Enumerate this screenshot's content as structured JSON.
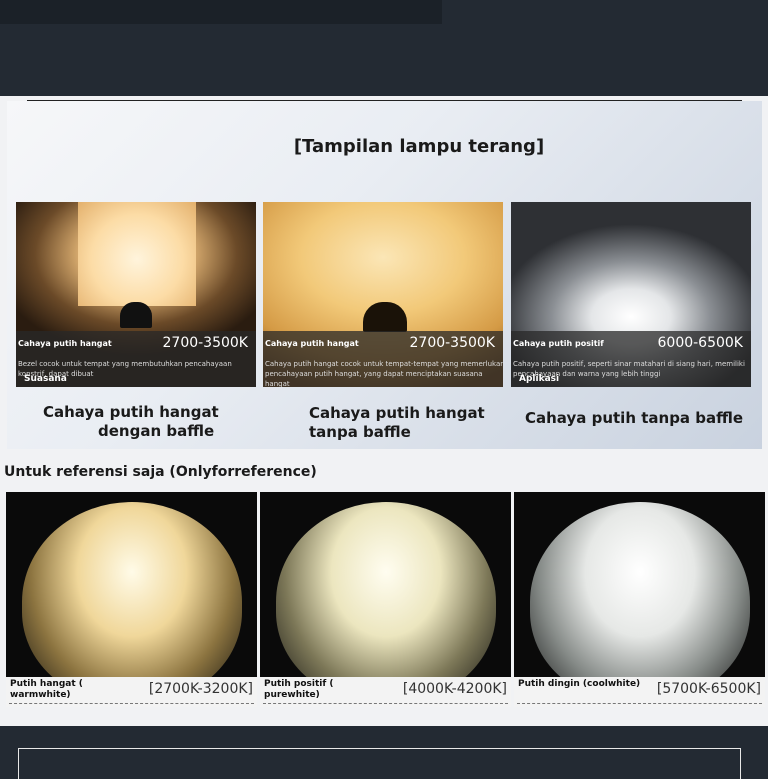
{
  "section1": {
    "heading": "[Tampilan lampu terang]",
    "cards": [
      {
        "caption": "Cahaya putih hangat",
        "temp": "2700-3500K",
        "desc": "Bezel cocok untuk tempat yang membutuhkan pencahayaan konstrif, dapat dibuat",
        "tag": "Suasana",
        "label_line1": "Cahaya putih hangat",
        "label_line2": "dengan baffle"
      },
      {
        "caption": "Cahaya putih hangat",
        "temp": "2700-3500K",
        "desc": "Cahaya putih hangat cocok untuk tempat-tempat yang memerlukan pencahayaan putih hangat, yang dapat menciptakan suasana hangat",
        "tag": "",
        "label_line1": "Cahaya putih hangat",
        "label_line2": "tanpa baffle"
      },
      {
        "caption": "Cahaya putih positif",
        "temp": "6000-6500K",
        "desc": "Cahaya putih positif, seperti sinar matahari di siang hari, memiliki pencahayaan dan warna yang lebih tinggi",
        "tag": "Aplikasi",
        "label_line1": "Cahaya putih tanpa baffle",
        "label_line2": ""
      }
    ]
  },
  "section2": {
    "heading": "Untuk referensi saja (Onlyforreference)",
    "cards": [
      {
        "name": "Putih hangat ( warmwhite)",
        "temp": "[2700K-3200K]"
      },
      {
        "name": "Putih positif ( purewhite)",
        "temp": "[4000K-4200K]"
      },
      {
        "name": "Putih dingin (coolwhite)",
        "temp": "[5700K-6500K]"
      }
    ]
  },
  "colors": {
    "background": "#232a33",
    "warm": "#f5d79a",
    "cool": "#ffffff"
  }
}
